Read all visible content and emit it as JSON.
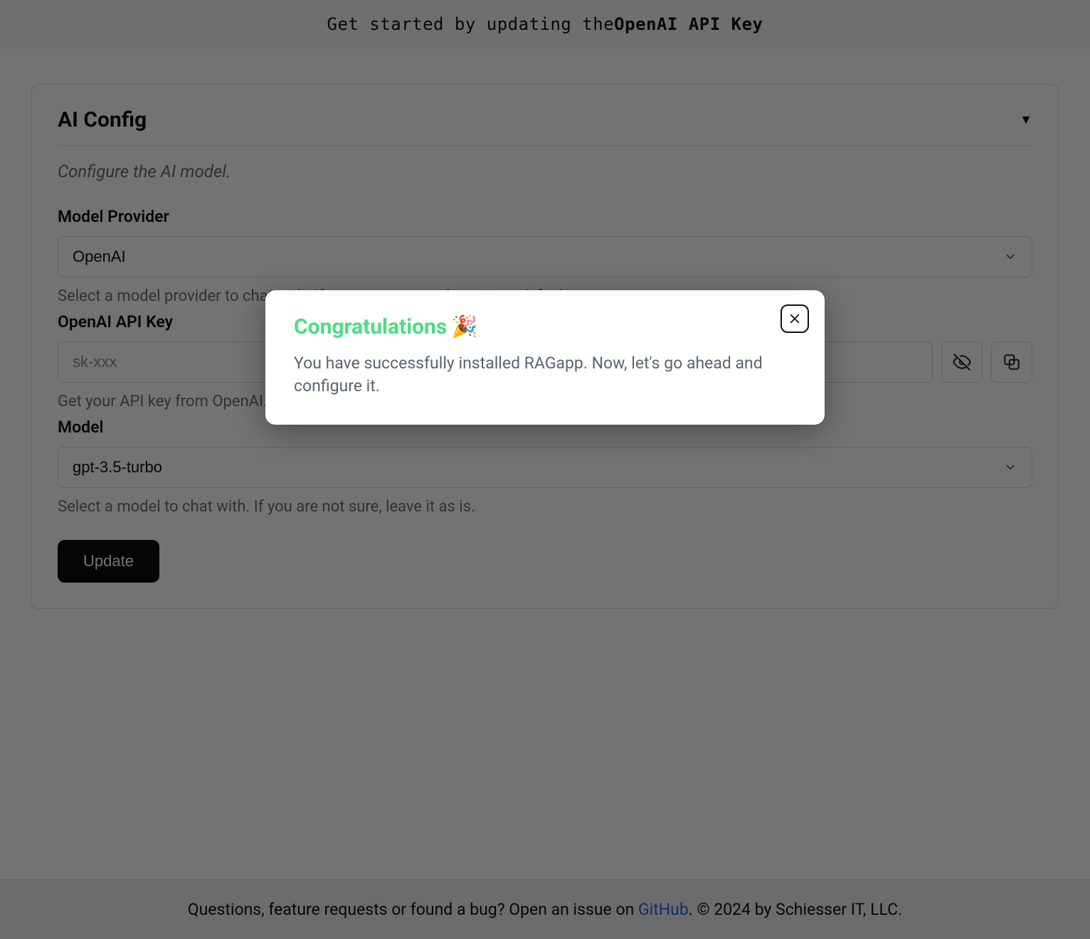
{
  "banner": {
    "prefix": "Get started by updating the ",
    "bold": "OpenAI API Key"
  },
  "card": {
    "title": "AI Config",
    "subtitle": "Configure the AI model."
  },
  "provider": {
    "label": "Model Provider",
    "value": "OpenAI",
    "helper": "Select a model provider to chat with. If you are not sure, leave it as default."
  },
  "api_key": {
    "label": "OpenAI API Key",
    "placeholder": "sk-xxx",
    "helper": "Get your API key from OpenAI."
  },
  "model": {
    "label": "Model",
    "value": "gpt-3.5-turbo",
    "helper": "Select a model to chat with. If you are not sure, leave it as is."
  },
  "update_label": "Update",
  "footer": {
    "text_before": "Questions, feature requests or found a bug? Open an issue on ",
    "link_text": "GitHub",
    "text_after": ". © 2024 by Schiesser IT, LLC."
  },
  "modal": {
    "title": "Congratulations",
    "emoji": "🎉",
    "body": "You have successfully installed RAGapp. Now, let's go ahead and configure it."
  }
}
